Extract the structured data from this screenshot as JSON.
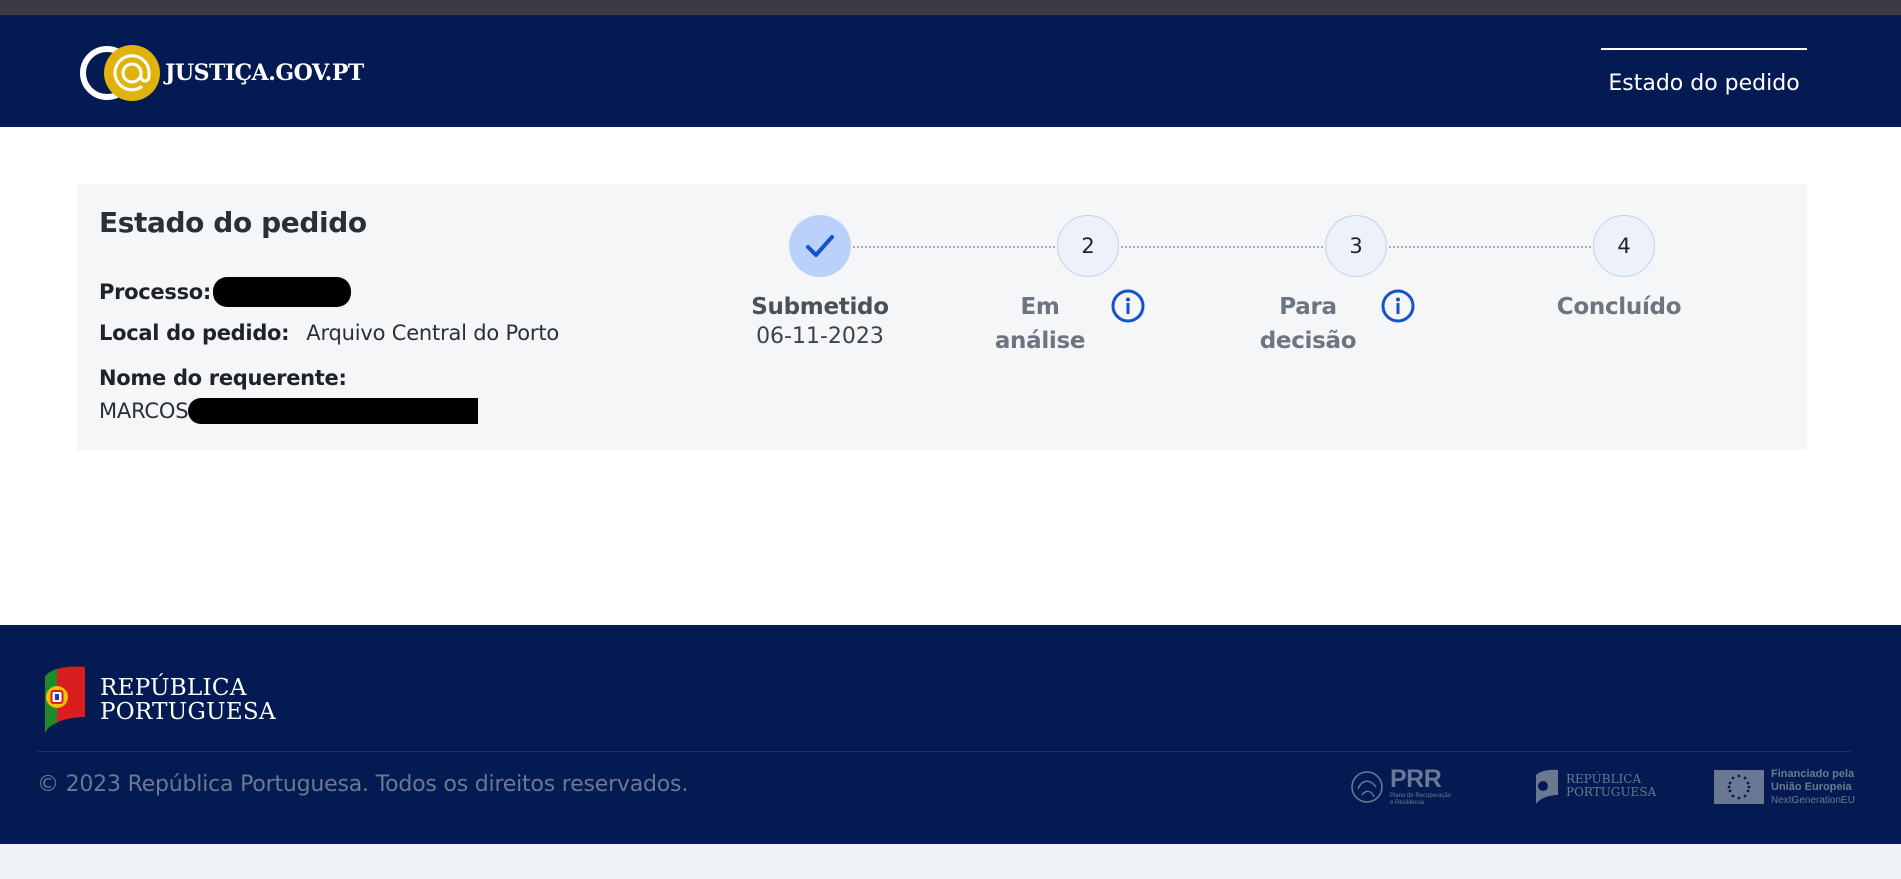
{
  "header": {
    "brand_name": "JUSTIÇA.GOV.PT",
    "nav_item": "Estado do pedido"
  },
  "card": {
    "title": "Estado do pedido",
    "process_label": "Processo:",
    "location_label": "Local do pedido:",
    "location_value": "Arquivo Central do Porto",
    "requester_label": "Nome do requerente:",
    "requester_value": "MARCOS"
  },
  "steps": [
    {
      "number": "",
      "label": "Submetido",
      "date": "06-11-2023",
      "state": "done",
      "has_info": false
    },
    {
      "number": "2",
      "label": "Em análise",
      "date": "",
      "state": "pending",
      "has_info": true
    },
    {
      "number": "3",
      "label": "Para decisão",
      "date": "",
      "state": "pending",
      "has_info": true
    },
    {
      "number": "4",
      "label": "Concluído",
      "date": "",
      "state": "pending",
      "has_info": false
    }
  ],
  "footer": {
    "brand_line1": "REPÚBLICA",
    "brand_line2": "PORTUGUESA",
    "copyright": "© 2023 República Portuguesa. Todos os direitos reservados.",
    "partners": {
      "prr_title": "PRR",
      "prr_sub1": "Plano de Recuperação",
      "prr_sub2": "e Resiliência",
      "rp_line1": "REPÚBLICA",
      "rp_line2": "PORTUGUESA",
      "eu_line1": "Financiado pela",
      "eu_line2": "União Europeia",
      "eu_line3": "NextGenerationEU"
    }
  },
  "colors": {
    "header_bg": "#031b52",
    "accent_yellow": "#e1b20c",
    "info_blue": "#1453c8",
    "done_circle": "#b9d1fb"
  },
  "icons": {
    "check": "check-icon",
    "info": "info-icon"
  }
}
